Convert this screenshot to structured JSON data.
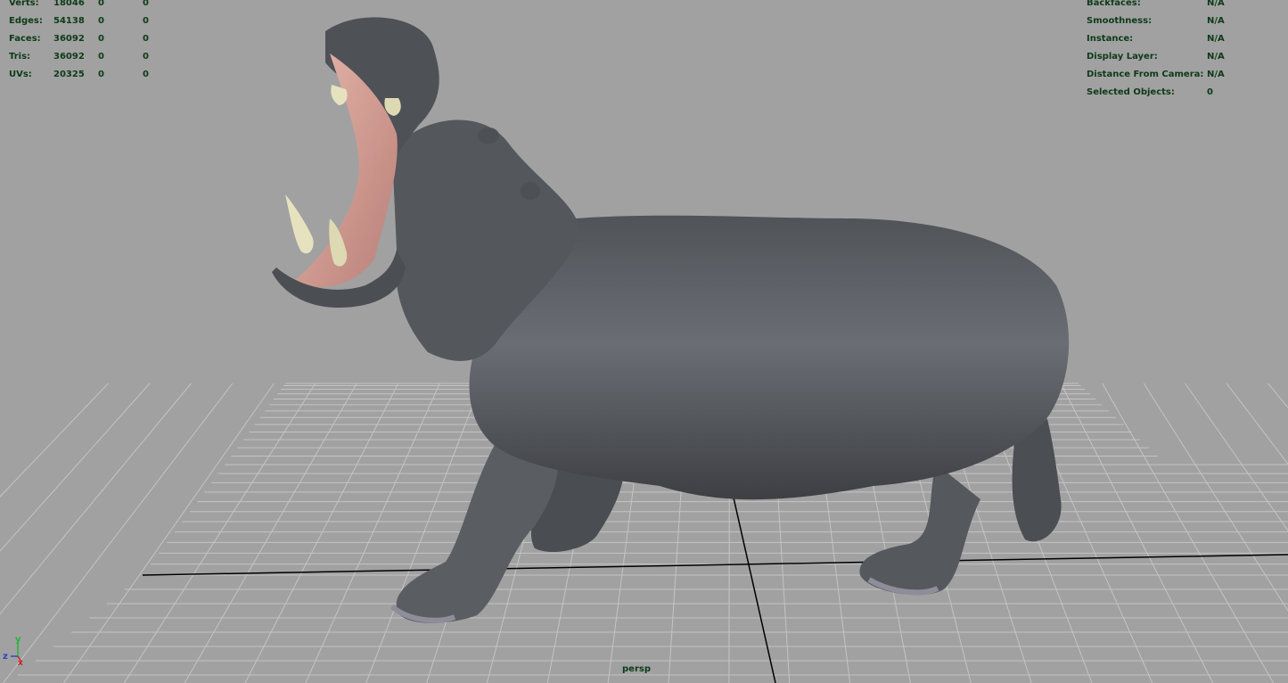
{
  "stats": {
    "rows": [
      {
        "label": "Verts:",
        "v1": "18046",
        "v2": "0",
        "v3": "0"
      },
      {
        "label": "Edges:",
        "v1": "54138",
        "v2": "0",
        "v3": "0"
      },
      {
        "label": "Faces:",
        "v1": "36092",
        "v2": "0",
        "v3": "0"
      },
      {
        "label": "Tris:",
        "v1": "36092",
        "v2": "0",
        "v3": "0"
      },
      {
        "label": "UVs:",
        "v1": "20325",
        "v2": "0",
        "v3": "0"
      }
    ]
  },
  "info": {
    "rows": [
      {
        "label": "Backfaces:",
        "value": "N/A"
      },
      {
        "label": "Smoothness:",
        "value": "N/A"
      },
      {
        "label": "Instance:",
        "value": "N/A"
      },
      {
        "label": "Display Layer:",
        "value": "N/A"
      },
      {
        "label": "Distance From Camera:",
        "value": "N/A"
      },
      {
        "label": "Selected Objects:",
        "value": "0"
      }
    ]
  },
  "camera": {
    "name": "persp"
  },
  "axis": {
    "y": "y",
    "z": "z",
    "x": "x"
  },
  "colors": {
    "background": "#a1a1a1",
    "grid": "#c4c4c4",
    "axis_line": "#000000",
    "hud_text": "#0d3a18",
    "model": "#5e6166"
  }
}
